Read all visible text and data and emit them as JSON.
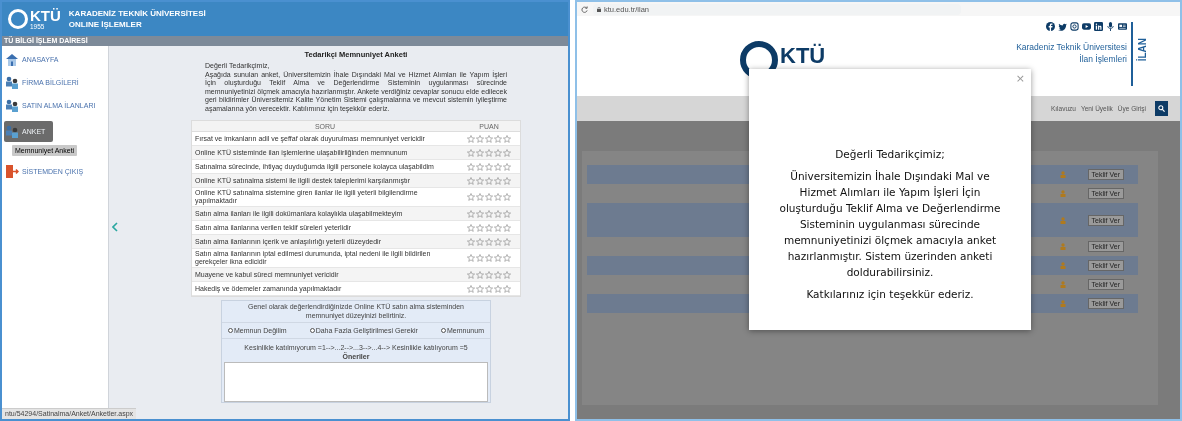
{
  "admin": {
    "header": {
      "logo_text": "KTÜ",
      "logo_year": "1955",
      "title_line1": "KARADENİZ TEKNİK ÜNİVERSİTESİ",
      "title_line2": "ONLINE İŞLEMLER"
    },
    "section_bar": "TÜ BİLGİ İŞLEM DAİRESİ",
    "sidebar": {
      "items": [
        {
          "label": "ANASAYFA",
          "kind": "home",
          "selected": false
        },
        {
          "label": "FİRMA BİLGİLERİ",
          "kind": "users",
          "selected": false
        },
        {
          "label": "SATIN ALMA İLANLARI",
          "kind": "users",
          "selected": false
        },
        {
          "label": "ANKET",
          "kind": "users",
          "selected": true,
          "children": [
            {
              "label": "Memnuniyet Anketi",
              "selected": true
            }
          ]
        },
        {
          "label": "SİSTEMDEN ÇIKIŞ",
          "kind": "exit",
          "selected": false
        }
      ]
    },
    "survey": {
      "title": "Tedarikçi Memnuniyet Anketi",
      "greeting": "Değerli Tedarikçimiz,",
      "intro": "Aşağıda sunulan anket, Üniversitemizin İhale Dışındaki Mal ve Hizmet Alımları ile Yapım İşleri İçin oluşturduğu Teklif Alma ve Değerlendirme Sisteminin uygulanması sürecinde memnuniyetinizi ölçmek amacıyla hazırlanmıştır. Ankete verdiğiniz cevaplar sonucu elde edilecek geri bildirimler Üniversitemiz Kalite Yönetim Sistemi çalışmalarına ve mevcut sistemin iyileştirme aşamalarına yön verecektir. Katılımınız için teşekkür ederiz.",
      "columns": [
        "SORU",
        "PUAN"
      ],
      "questions": [
        {
          "text": "Fırsat ve imkanların adil ve şeffaf olarak duyurulması memnuniyet vericidir",
          "stars": 0
        },
        {
          "text": "Online KTÜ sisteminde ilan işlemlerine ulaşabilirliğinden memnunum",
          "stars": 0
        },
        {
          "text": "Satınalma sürecinde, ihtiyaç duyduğumda ilgili personele kolayca ulaşabildim",
          "stars": 0
        },
        {
          "text": "Online KTÜ satınalma sistemi ile ilgili destek taleplerimi karşılanmıştır",
          "stars": 0
        },
        {
          "text": "Online KTÜ satınalma sistemine giren ilanlar ile ilgili yeterli bilgilendirme yapılmaktadır",
          "stars": 0
        },
        {
          "text": "Satın alma ilanları ile ilgili dokümanlara kolaylıkla ulaşabilmekteyim",
          "stars": 0
        },
        {
          "text": "Satın alma ilanlarına verilen teklif süreleri yeterlidir",
          "stars": 0
        },
        {
          "text": "Satın alma ilanlarının içerik ve anlaşılırlığı yeterli düzeydedir",
          "stars": 0
        },
        {
          "text": "Satın alma ilanlarının iptal edilmesi durumunda, iptal nedeni ile ilgili bildirilen gerekçeler ikna edicidir",
          "stars": 0
        },
        {
          "text": "Muayene ve kabul süreci memnuniyet vericidir",
          "stars": 0
        },
        {
          "text": "Hakediş ve ödemeler zamanında yapılmaktadır",
          "stars": 0
        }
      ],
      "overall": {
        "question": "Genel olarak değerlendirdiğinizde Online KTÜ satın alma sisteminden memnuniyet düzeyinizi belirtiniz.",
        "options": [
          {
            "label": "Memnun Değilim",
            "selected": false
          },
          {
            "label": "Daha Fazla Geliştirilmesi Gerekir",
            "selected": false
          },
          {
            "label": "Memnunum",
            "selected": false
          }
        ],
        "scale": "Kesinlikle katılmıyorum =1-->...2-->...3-->...4--> Kesinlikle katılıyorum =5",
        "suggestions_label": "Öneriler"
      }
    },
    "status_bar": "ntu/54294/Satinalma/Anket/Anketler.aspx"
  },
  "site": {
    "address": "ktu.edu.tr/ilan",
    "logo_text": "KTÜ",
    "university": "Karadeniz Teknik Üniversitesi",
    "section": "İlan İşlemleri",
    "vertical_label": "İLAN",
    "nav": [
      "Kılavuzu",
      "Yeni Üyelik",
      "Üye Girişi"
    ],
    "offer_buttons": [
      "Teklif Ver",
      "Teklif Ver",
      "Teklif Ver",
      "Teklif Ver",
      "Teklif Ver",
      "Teklif Ver",
      "Teklif Ver"
    ],
    "modal": {
      "close": "×",
      "greeting": "Değerli Tedarikçimiz;",
      "body": "Üniversitemizin İhale Dışındaki Mal ve Hizmet Alımları ile Yapım İşleri İçin oluşturduğu Teklif Alma ve Değerlendirme Sisteminin uygulanması sürecinde memnuniyetinizi ölçmek amacıyla anket hazırlanmıştır. Sistem üzerinden anketi doldurabilirsiniz.",
      "thanks": "Katkılarınız için teşekkür ederiz."
    }
  }
}
